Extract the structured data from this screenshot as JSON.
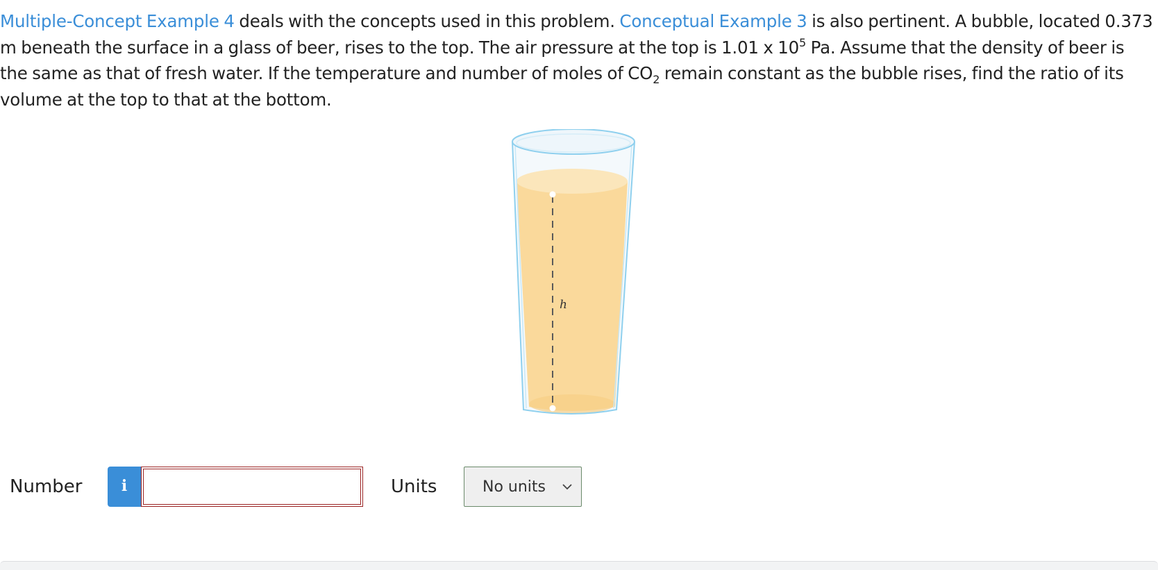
{
  "problem": {
    "link1": "Multiple-Concept Example 4",
    "text1": " deals with the concepts used in this problem. ",
    "link2": "Conceptual Example 3",
    "text2": " is also pertinent. A bubble, located 0.373 m beneath the surface in a glass of beer, rises to the top. The air pressure at the top is 1.01 x 10",
    "sup": "5",
    "text3": " Pa. Assume that the density of beer is the same as that of fresh water. If the temperature and number of moles of CO",
    "sub": "2",
    "text4": " remain constant as the bubble rises, find the ratio of its volume at the top to that at the bottom."
  },
  "figure": {
    "height_label": "h"
  },
  "answer": {
    "number_label": "Number",
    "info_glyph": "i",
    "number_value": "",
    "units_label": "Units",
    "units_selected": "No units"
  },
  "colors": {
    "link": "#3a8ed8",
    "info_button": "#3a8ed8",
    "input_border": "#9a2222",
    "beer": "#fad99b",
    "glass_outline": "#8fd0ee"
  },
  "icons": {
    "info": "info-icon",
    "dropdown": "chevron-down-icon"
  }
}
